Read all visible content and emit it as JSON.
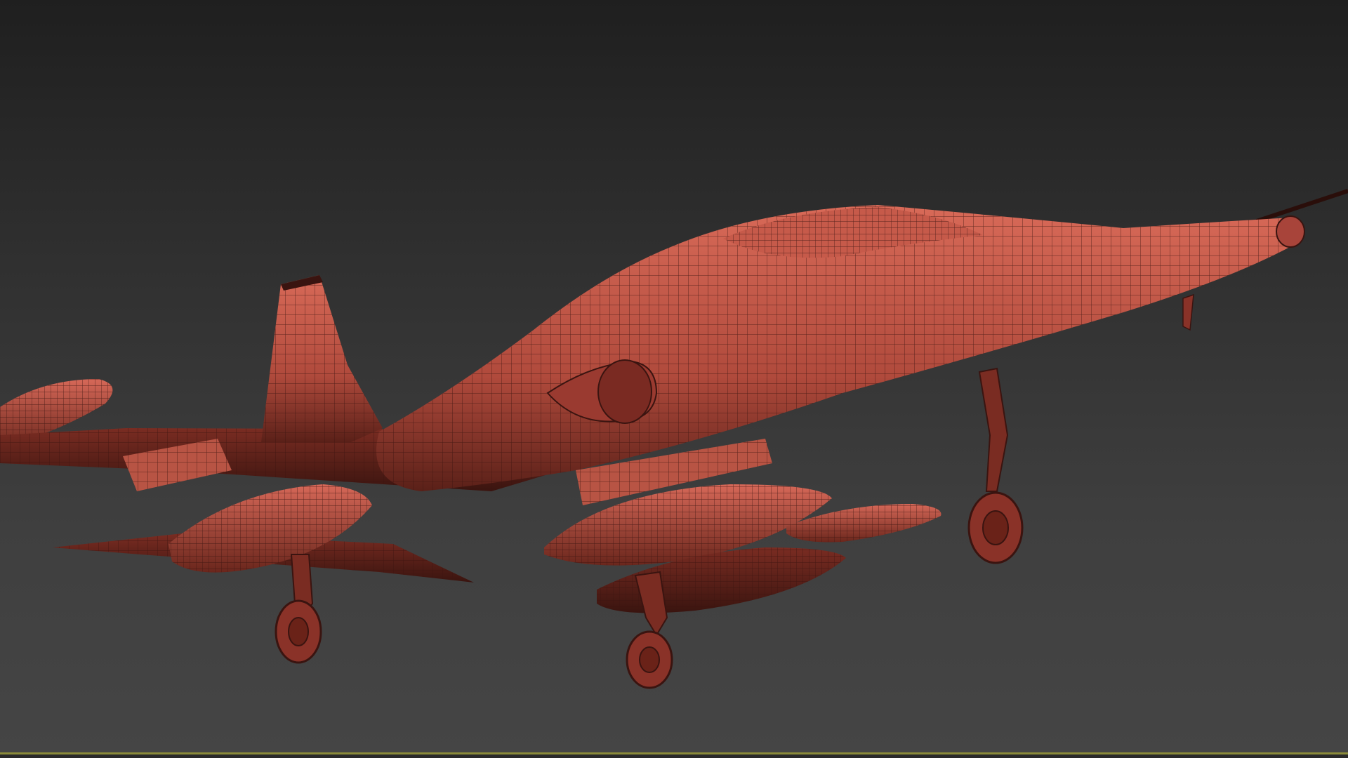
{
  "viewport": {
    "shading_mode": "wireframe-on-shaded",
    "model_color": "#c4584a",
    "wire_color": "#3a1410",
    "background_top": "#1f1f1f",
    "background_bottom": "#454545",
    "active_border_color": "#8a8a3a"
  }
}
